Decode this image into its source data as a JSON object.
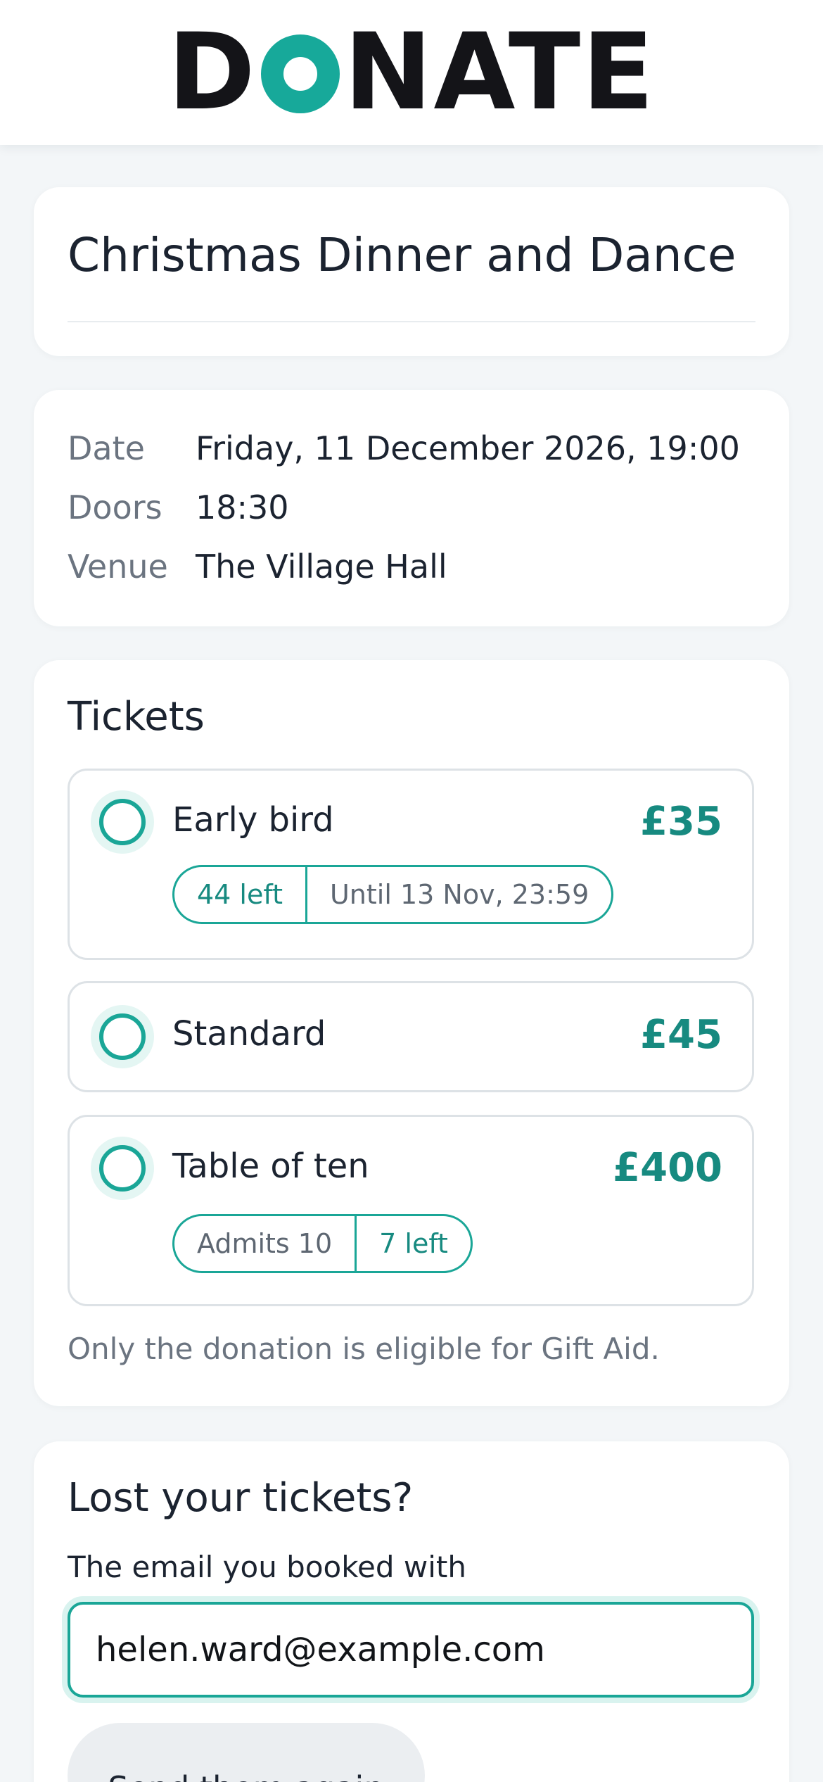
{
  "header": {
    "logo_text_left": "D",
    "logo_text_right": "NATE"
  },
  "event": {
    "title": "Christmas Dinner and Dance"
  },
  "details": [
    {
      "label": "Date",
      "value": "Friday, 11 December 2026, 19:00"
    },
    {
      "label": "Doors",
      "value": "18:30"
    },
    {
      "label": "Venue",
      "value": "The Village Hall"
    }
  ],
  "tickets": {
    "heading": "Tickets",
    "items": [
      {
        "name": "Early bird",
        "price": "£35",
        "pills": [
          "44 left",
          "Until 13 Nov, 23:59"
        ]
      },
      {
        "name": "Standard",
        "price": "£45"
      },
      {
        "name": "Table of ten",
        "price": "£400",
        "pills": [
          "Admits 10",
          "7 left"
        ]
      }
    ],
    "note": "Only the donation is eligible for Gift Aid."
  },
  "lost": {
    "heading": "Lost your tickets?",
    "field_label": "The email you booked with",
    "email_value": "helen.ward@example.com",
    "button_label": "Send them again"
  },
  "colors": {
    "accent": "#1aa697",
    "price": "#178a80",
    "background": "#f3f6f8"
  }
}
